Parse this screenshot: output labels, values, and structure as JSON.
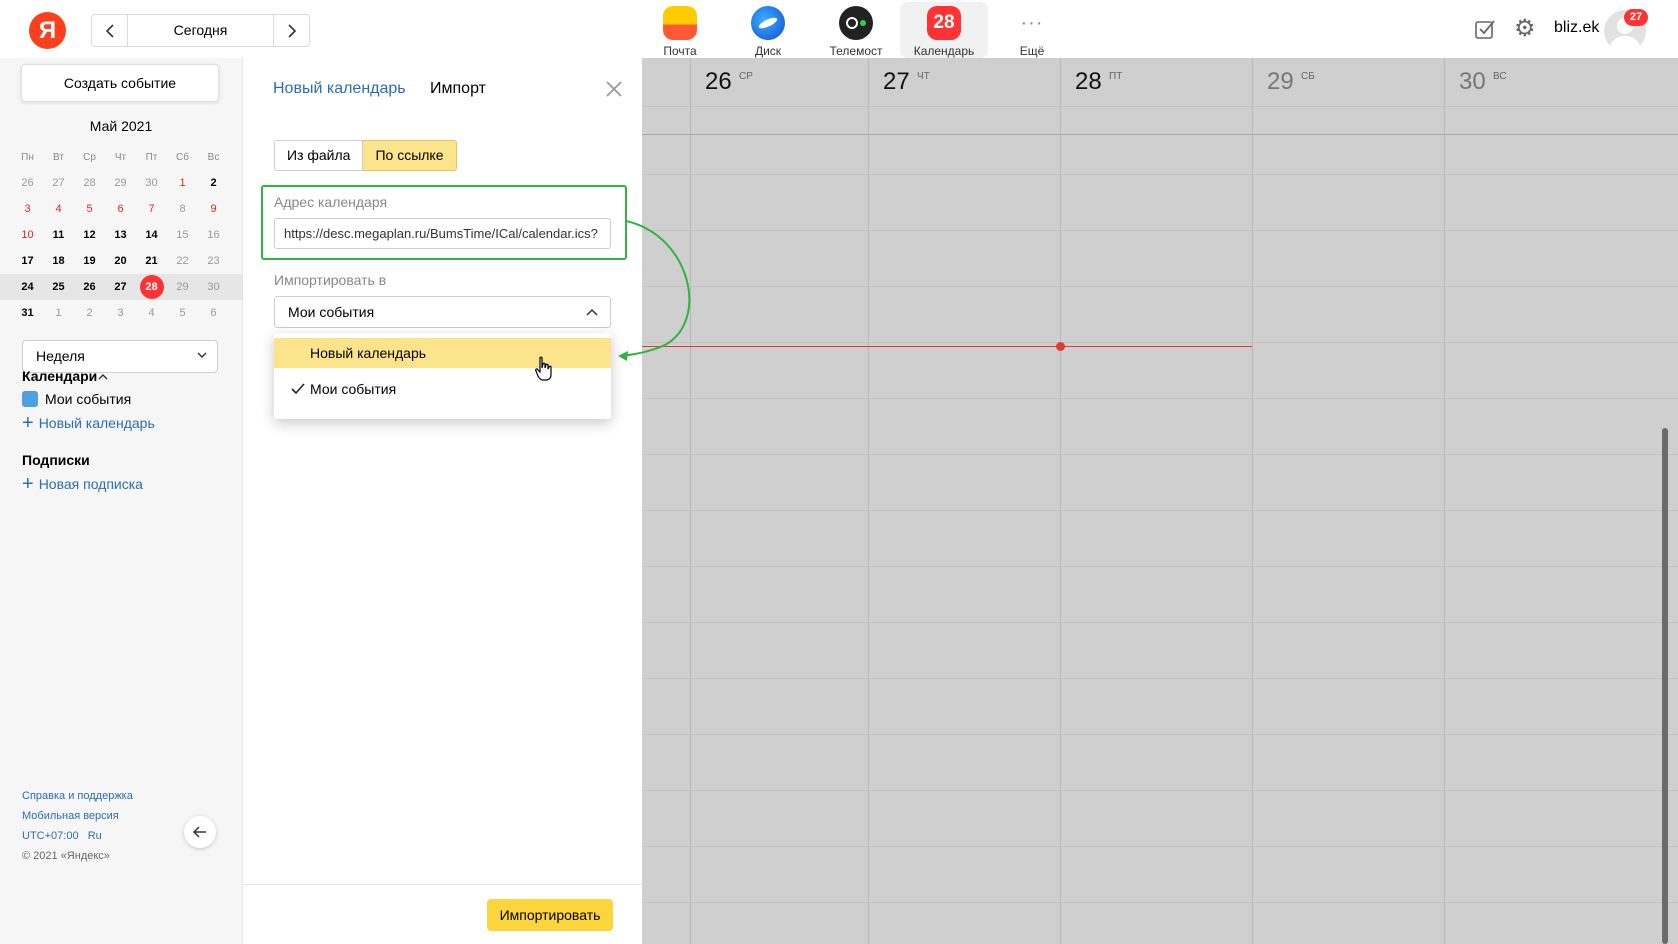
{
  "header": {
    "logo": "Я",
    "date_nav": {
      "today_label": "Сегодня"
    },
    "services": [
      {
        "icon": "mail-icon",
        "label": "Почта"
      },
      {
        "icon": "disk-icon",
        "label": "Диск"
      },
      {
        "icon": "telemost-icon",
        "label": "Телемост"
      },
      {
        "icon": "calendar-icon",
        "label": "Календарь",
        "badge_text": "28",
        "active": true
      },
      {
        "icon": "more-icon",
        "label": "Ещё"
      }
    ],
    "username": "bliz.ek",
    "notification_count": "27"
  },
  "sidebar": {
    "create_button": "Создать событие",
    "month_title": "Май 2021",
    "weekday_headers": [
      "Пн",
      "Вт",
      "Ср",
      "Чт",
      "Пт",
      "Сб",
      "Вс"
    ],
    "weeks": [
      [
        "26",
        "27",
        "28",
        "29",
        "30",
        "1",
        "2"
      ],
      [
        "3",
        "4",
        "5",
        "6",
        "7",
        "8",
        "9"
      ],
      [
        "10",
        "11",
        "12",
        "13",
        "14",
        "15",
        "16"
      ],
      [
        "17",
        "18",
        "19",
        "20",
        "21",
        "22",
        "23"
      ],
      [
        "24",
        "25",
        "26",
        "27",
        "28",
        "29",
        "30"
      ],
      [
        "31",
        "1",
        "2",
        "3",
        "4",
        "5",
        "6"
      ]
    ],
    "today_day": "28",
    "view_select": "Неделя",
    "calendars_title": "Календари",
    "calendar_items": [
      {
        "label": "Мои события",
        "color": "#4da1e1"
      }
    ],
    "add_calendar": "Новый календарь",
    "subscriptions_title": "Подписки",
    "add_subscription": "Новая подписка",
    "footer": {
      "help": "Справка и поддержка",
      "mobile": "Мобильная версия",
      "timezone": "UTC+07:00",
      "lang": "Ru",
      "copyright": "© 2021 «Яндекс»"
    }
  },
  "import_panel": {
    "tab_new_calendar": "Новый календарь",
    "tab_import": "Импорт",
    "source_options": {
      "from_file": "Из файла",
      "by_link": "По ссылке",
      "selected": "by_link"
    },
    "address_label": "Адрес календаря",
    "address_value": "https://desc.megaplan.ru/BumsTime/ICal/calendar.ics?",
    "import_to_label": "Импортировать в",
    "import_to_value": "Мои события",
    "dropdown_options": [
      {
        "label": "Новый календарь",
        "highlighted": true
      },
      {
        "label": "Мои события",
        "checked": true
      }
    ],
    "import_button": "Импортировать"
  },
  "week_view": {
    "days": [
      {
        "num": "26",
        "wd": "СР"
      },
      {
        "num": "27",
        "wd": "ЧТ"
      },
      {
        "num": "28",
        "wd": "ПТ"
      },
      {
        "num": "29",
        "wd": "СБ"
      },
      {
        "num": "30",
        "wd": "ВС"
      }
    ]
  },
  "colors": {
    "accent_yellow": "#fcd43b",
    "highlight_green": "#2fb341",
    "link_blue": "#2a6db3",
    "today_red": "#f33"
  }
}
